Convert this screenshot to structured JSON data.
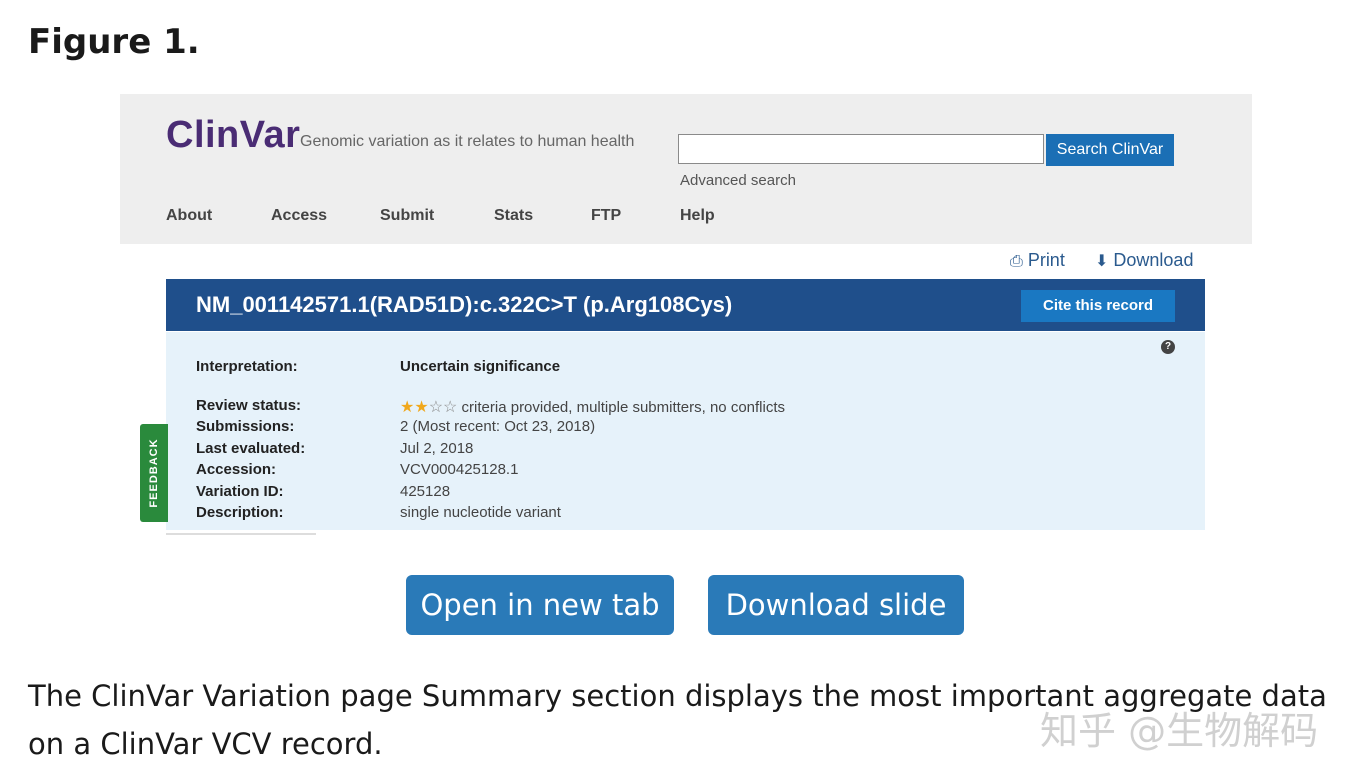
{
  "figure": {
    "title": "Figure 1."
  },
  "clinvar": {
    "logo": "ClinVar",
    "tagline": "Genomic variation as it relates to human health",
    "search": {
      "placeholder": "",
      "button": "Search ClinVar",
      "advanced": "Advanced search"
    },
    "nav": [
      "About",
      "Access",
      "Submit",
      "Stats",
      "FTP",
      "Help"
    ],
    "tools": {
      "print": "Print",
      "download": "Download"
    },
    "record": {
      "title": "NM_001142571.1(RAD51D):c.322C>T (p.Arg108Cys)",
      "cite_button": "Cite this record",
      "interpretation_label": "Interpretation:",
      "interpretation_value": "Uncertain significance",
      "review_status_label": "Review status:",
      "review_status_value": "criteria provided, multiple submitters, no conflicts",
      "stars_filled": 2,
      "stars_total": 4,
      "submissions_label": "Submissions:",
      "submissions_value": "2 (Most recent: Oct 23, 2018)",
      "last_evaluated_label": "Last evaluated:",
      "last_evaluated_value": "Jul 2, 2018",
      "accession_label": "Accession:",
      "accession_value": "VCV000425128.1",
      "variation_id_label": "Variation ID:",
      "variation_id_value": "425128",
      "description_label": "Description:",
      "description_value": "single nucleotide variant"
    },
    "feedback": "FEEDBACK"
  },
  "actions": {
    "open_new_tab": "Open in new tab",
    "download_slide": "Download slide"
  },
  "caption": "The ClinVar Variation page Summary section displays the most important aggregate data on a ClinVar VCV record.",
  "watermark": "知乎 @生物解码",
  "colors": {
    "banner": "#1f4f8b",
    "panel": "#e6f2fa",
    "button": "#2a7ab8",
    "logo": "#4a2c74"
  }
}
